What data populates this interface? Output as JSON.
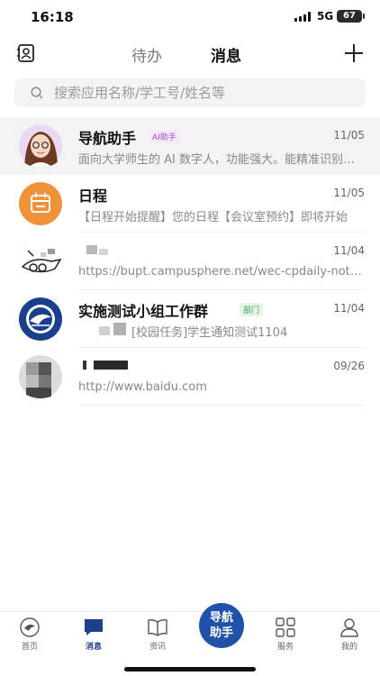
{
  "status_bar": {
    "time": "16:18",
    "network": "5G",
    "battery": "67"
  },
  "header": {
    "tab_todo": "待办",
    "tab_messages": "消息"
  },
  "search": {
    "placeholder": "搜索应用名称/学工号/姓名等"
  },
  "conversations": [
    {
      "title": "导航助手",
      "tag": "AI助手",
      "date": "11/05",
      "preview": "面向大学师生的 AI 数字人，功能强大。能精准识别和查询各类信息"
    },
    {
      "title": "日程",
      "date": "11/05",
      "preview": "【日程开始提醒】您的日程【会议室预约】即将开始"
    },
    {
      "title": "",
      "date": "11/04",
      "preview": "https://bupt.campusphere.net/wec-cpdaily-notice"
    },
    {
      "title": "实施测试小组工作群",
      "tag": "部门",
      "date": "11/04",
      "preview": "[校园任务]学生通知测试1104"
    },
    {
      "title": "",
      "date": "09/26",
      "preview": "http://www.baidu.com"
    }
  ],
  "bottom_nav": {
    "home": "首页",
    "messages": "消息",
    "news": "资讯",
    "assistant_line1": "导航",
    "assistant_line2": "助手",
    "services": "服务",
    "mine": "我的"
  },
  "colors": {
    "accent": "#1f52a8",
    "nav_active": "#1d3f8a",
    "calendar": "#f0923a",
    "ai_tag": "#a34fc7",
    "dept_tag": "#3aa160"
  }
}
